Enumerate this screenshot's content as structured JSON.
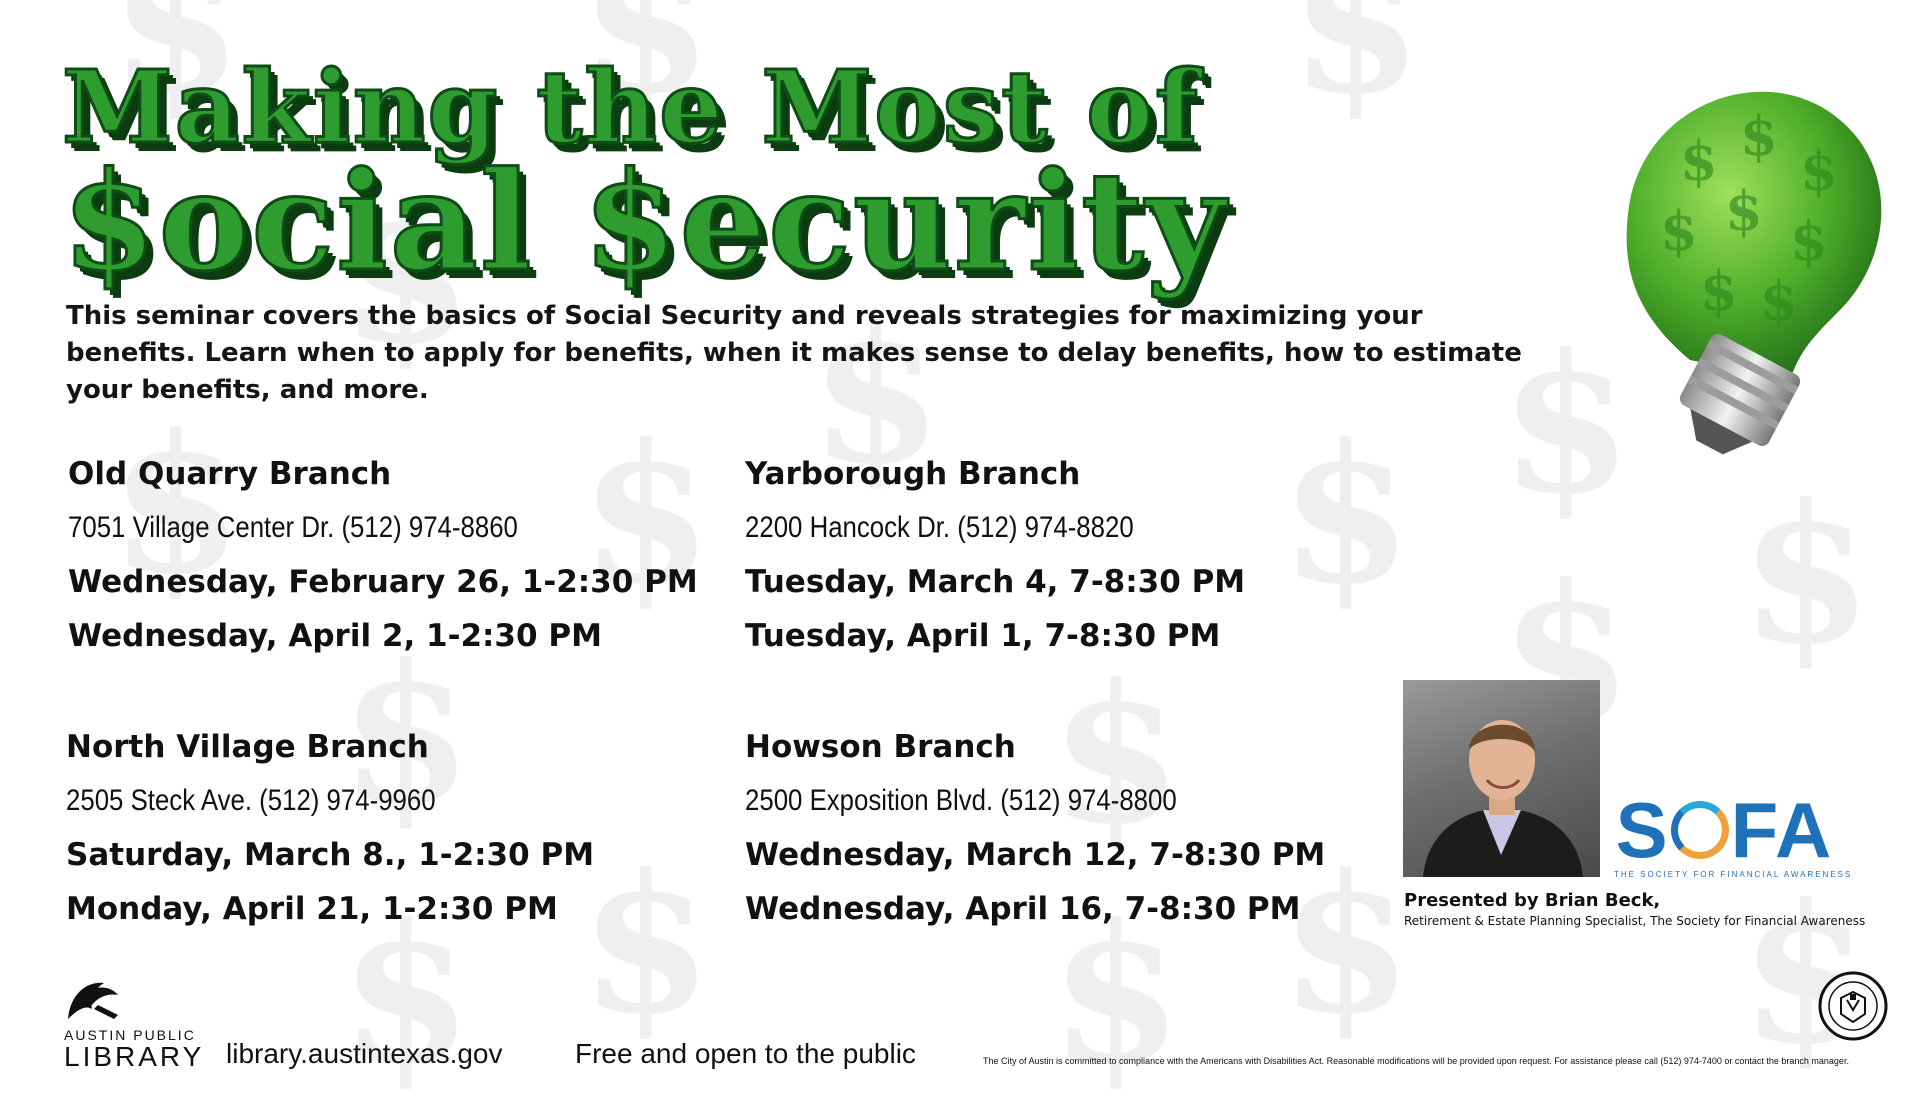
{
  "title": {
    "line1": "Making the Most of",
    "line2": "$ocial $ecurity"
  },
  "background_symbol": "$",
  "intro": "This seminar covers the basics of Social Security and reveals strategies for maximizing your benefits. Learn when to apply for benefits, when it makes sense to delay benefits, how to estimate your benefits, and more.",
  "branches": [
    {
      "name": "Old Quarry Branch",
      "address": "7051 Village Center Dr. (512) 974-8860",
      "dates": [
        "Wednesday, February 26, 1-2:30 PM",
        "Wednesday, April 2, 1-2:30 PM"
      ]
    },
    {
      "name": "Yarborough Branch",
      "address": "2200 Hancock Dr. (512) 974-8820",
      "dates": [
        "Tuesday, March 4, 7-8:30 PM",
        "Tuesday, April 1, 7-8:30 PM"
      ]
    },
    {
      "name": "North Village Branch",
      "address": "2505 Steck Ave. (512) 974-9960",
      "dates": [
        "Saturday, March 8., 1-2:30 PM",
        "Monday, April 21, 1-2:30 PM"
      ]
    },
    {
      "name": "Howson Branch",
      "address": "2500 Exposition Blvd. (512) 974-8800",
      "dates": [
        "Wednesday, March 12, 7-8:30 PM",
        "Wednesday, April 16, 7-8:30 PM"
      ]
    }
  ],
  "presenter": {
    "name": "Presented by Brian Beck,",
    "role": "Retirement & Estate Planning Specialist, The Society for Financial Awareness"
  },
  "sofa": {
    "letters_left": "S",
    "letters_right": "FA",
    "tagline": "The Society for Financial Awareness"
  },
  "library": {
    "line1": "AUSTIN PUBLIC",
    "line2": "LIBRARY"
  },
  "footer": {
    "url": "library.austintexas.gov",
    "free": "Free and open to the public",
    "legal": "The City of Austin is committed to compliance with the Americans with Disabilities Act. Reasonable modifications will be provided upon request. For assistance please call (512) 974-7400 or contact the branch manager."
  },
  "colors": {
    "title_green": "#2f9c2f",
    "title_dark": "#0e4d16",
    "sofa_blue": "#1f72b8",
    "sofa_orange": "#f2a13a"
  },
  "icons": {
    "bulb": "money-lightbulb-icon",
    "library": "austin-library-logo-icon",
    "seal": "city-of-austin-seal-icon"
  }
}
